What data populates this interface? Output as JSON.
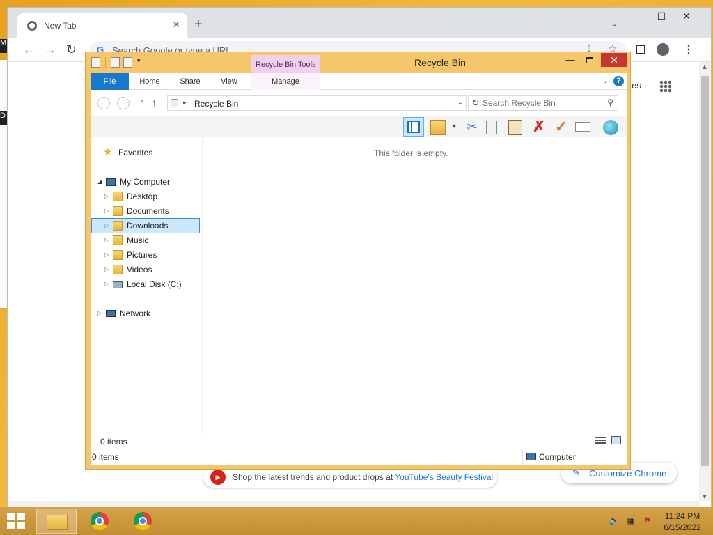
{
  "desktop": {
    "left_edge_label_1": "M",
    "left_edge_label_2": "D"
  },
  "chrome": {
    "tab_title": "New Tab",
    "tab_close": "✕",
    "new_tab_symbol": "+",
    "tab_search_symbol": "⌄",
    "win_minimize": "—",
    "win_maximize": "☐",
    "win_close": "✕",
    "back_symbol": "←",
    "forward_symbol": "→",
    "reload_symbol": "↻",
    "google_g": "G",
    "omnibox_placeholder": "Search Google or type a URL",
    "share_symbol": "⇪",
    "star_symbol": "☆",
    "menu_symbol": "⋮",
    "ntp_partial_text": "es",
    "promo_text": "Shop the latest trends and product drops at ",
    "promo_link": "YouTube's Beauty Festival",
    "customize_label": "Customize Chrome",
    "customize_icon": "✎"
  },
  "explorer": {
    "title": "Recycle Bin",
    "context_tab": "Recycle Bin Tools",
    "close_symbol": "✕",
    "min_symbol": "—",
    "ribbon_tabs": [
      "File",
      "Home",
      "Share",
      "View",
      "Manage"
    ],
    "ribbon_help": "?",
    "ribbon_chevron": "⌄",
    "address_path": "Recycle Bin",
    "address_sep": "▸",
    "address_dd": "⌄",
    "refresh_symbol": "↻",
    "search_placeholder": "Search Recycle Bin",
    "search_symbol": "⚲",
    "back_symbol": "←",
    "forward_symbol": "→",
    "up_symbol": "↑",
    "empty_message": "This folder is empty.",
    "nav": {
      "favorites": "Favorites",
      "my_computer": "My Computer",
      "desktop": "Desktop",
      "documents": "Documents",
      "downloads": "Downloads",
      "music": "Music",
      "pictures": "Pictures",
      "videos": "Videos",
      "local_disk": "Local Disk (C:)",
      "network": "Network"
    },
    "info_count": "0 items",
    "status_count": "0 items",
    "status_location": "Computer",
    "toolbar_icons": [
      "preview-pane-icon",
      "properties-icon",
      "cut-icon",
      "copy-icon",
      "paste-icon",
      "delete-icon",
      "rename-icon",
      "new-item-icon",
      "globe-icon"
    ],
    "toolbar_glyphs": {
      "cut": "✂",
      "delete": "✗",
      "check": "✓",
      "dropdown": "▾"
    }
  },
  "taskbar": {
    "time": "11:24 PM",
    "date": "6/15/2022",
    "tray_glyphs": {
      "speaker": "🔈",
      "network": "▦",
      "flag": "⚑"
    }
  },
  "colors": {
    "explorer_frame": "#f5c66a",
    "file_tab": "#1979ca",
    "context_tab": "#f1d0ec",
    "close_button": "#c7372f",
    "selection": "#cce8ff",
    "taskbar": "#c38f32"
  }
}
